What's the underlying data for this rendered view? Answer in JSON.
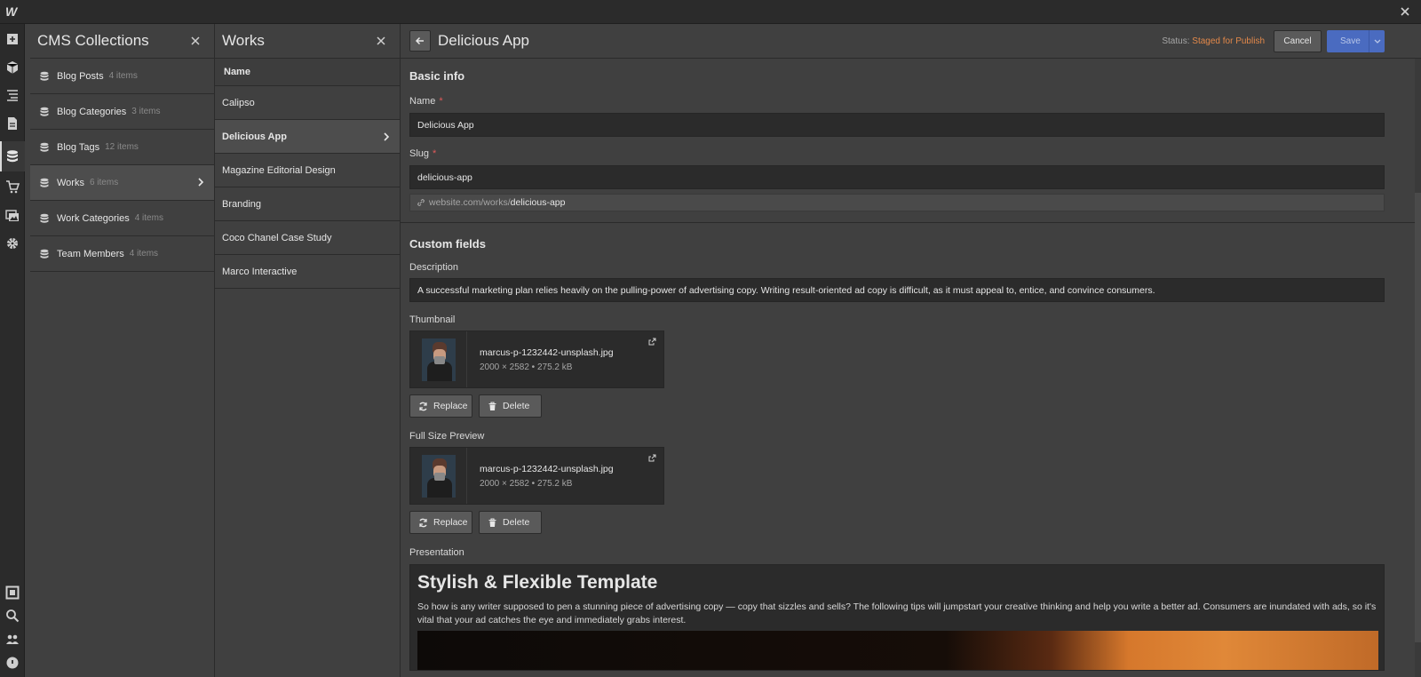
{
  "app": {
    "logo": "W"
  },
  "collections": {
    "title": "CMS Collections",
    "items": [
      {
        "name": "Blog Posts",
        "count": "4 items"
      },
      {
        "name": "Blog Categories",
        "count": "3 items"
      },
      {
        "name": "Blog Tags",
        "count": "12 items"
      },
      {
        "name": "Works",
        "count": "6 items"
      },
      {
        "name": "Work Categories",
        "count": "4 items"
      },
      {
        "name": "Team Members",
        "count": "4 items"
      }
    ]
  },
  "works": {
    "title": "Works",
    "column_header": "Name",
    "items": [
      "Calipso",
      "Delicious App",
      "Magazine Editorial Design",
      "Branding",
      "Coco Chanel Case Study",
      "Marco Interactive"
    ]
  },
  "editor": {
    "title": "Delicious App",
    "status_label": "Status:",
    "status_value": "Staged for Publish",
    "cancel_label": "Cancel",
    "save_label": "Save",
    "basic": {
      "title": "Basic info",
      "name_label": "Name",
      "name_value": "Delicious App",
      "slug_label": "Slug",
      "slug_value": "delicious-app",
      "slug_prefix": "website.com/works/",
      "slug_suffix": "delicious-app"
    },
    "custom": {
      "title": "Custom fields",
      "description_label": "Description",
      "description_value": "A successful marketing plan relies heavily on the pulling-power of advertising copy. Writing result-oriented ad copy is difficult, as it must appeal to, entice, and convince consumers.",
      "thumbnail_label": "Thumbnail",
      "thumbnail_file": "marcus-p-1232442-unsplash.jpg",
      "thumbnail_meta": "2000 × 2582 • 275.2 kB",
      "preview_label": "Full Size Preview",
      "preview_file": "marcus-p-1232442-unsplash.jpg",
      "preview_meta": "2000 × 2582 • 275.2 kB",
      "replace_label": "Replace",
      "delete_label": "Delete",
      "presentation_label": "Presentation",
      "presentation_heading": "Stylish & Flexible Template",
      "presentation_body": "So how is any writer supposed to pen a stunning piece of advertising copy — copy that sizzles and sells? The following tips will jumpstart your creative thinking and help you write a better ad. Consumers are inundated with ads, so it's vital that your ad catches the eye and immediately grabs interest."
    }
  },
  "colors": {
    "status_accent": "#e2884a",
    "save_button": "#4a6bc0",
    "required_marker": "#e05a5a"
  }
}
